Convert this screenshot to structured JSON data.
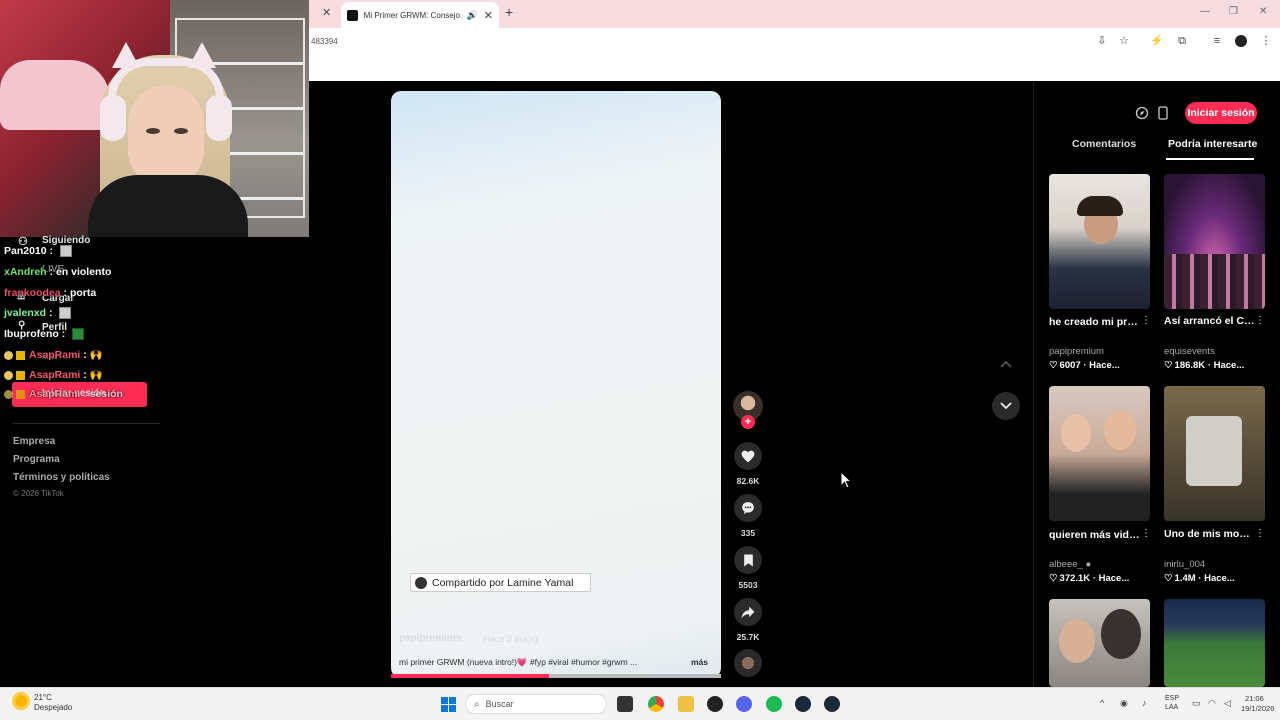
{
  "browser": {
    "tab_title": "Mi Primer GRWM: Consejo",
    "address_fragment": "483394"
  },
  "sidebar": {
    "ghost_items": [
      "Siguiendo",
      "LIVE",
      "Cargar",
      "Perfil",
      "Más"
    ],
    "login_label": "Iniciar sesión",
    "footer_links": [
      "Empresa",
      "Programa",
      "Términos y políticas"
    ],
    "copyright": "© 2026 TikTok"
  },
  "chat": [
    {
      "user": "Pan2010",
      "text": "",
      "color": "#ffffff",
      "emote": true
    },
    {
      "user": "xAndreh",
      "text": "en violento",
      "color": "#6fe36f",
      "emote": false
    },
    {
      "user": "frankoodea",
      "text": "porta",
      "color": "#e8506a",
      "emote": false
    },
    {
      "user": "jvalenxd",
      "text": "",
      "color": "#7ef0a0",
      "emote": true
    },
    {
      "user": "Ibuprofeno",
      "text": "",
      "color": "#ffffff",
      "emote": false
    },
    {
      "user": "AsapRami",
      "text": "🙌",
      "color": "#f05a6e",
      "emote": false
    },
    {
      "user": "AsapRami",
      "text": "🙌",
      "color": "#f05a6e",
      "emote": false
    },
    {
      "user": "AsapRami",
      "text": "sesión",
      "color": "#f05a6e",
      "emote": false
    }
  ],
  "video": {
    "shared_by": "Compartido por Lamine Yamal",
    "username": "papipremium",
    "time_ago": "· Hace 2 día(s)",
    "description": "mi primer GRWM (nueva intro!)💗 #fyp #viral #humor #grwm ...",
    "more_label": "más",
    "progress": 0.48,
    "likes": "82.6K",
    "comments": "335",
    "saves": "5503",
    "shares": "25.7K"
  },
  "right_panel": {
    "login_button": "Iniciar sesión",
    "tabs": [
      "Comentarios",
      "Podría interesarte"
    ],
    "active_tab": 1,
    "recommendations": [
      {
        "title": "he creado mi propio gta VI 💪 ...",
        "author": "papipremium",
        "likes": "6007",
        "time": "· Hace..."
      },
      {
        "title": "Así arrancó el CUMPLE DEL AÑ...",
        "author": "equisevents",
        "likes": "186.8K",
        "time": "· Hace..."
      },
      {
        "title": "quieren más videos así? 💗 🎤",
        "author": "albeee_ ●",
        "likes": "372.1K",
        "time": "· Hace..."
      },
      {
        "title": "Uno de mis momentos más...",
        "author": "inirlu_004",
        "likes": "1.4M",
        "time": "· Hace..."
      },
      {
        "title": "",
        "author": "",
        "likes": "",
        "time": ""
      },
      {
        "title": "",
        "author": "",
        "likes": "",
        "time": ""
      }
    ]
  },
  "taskbar": {
    "temperature": "21°C",
    "weather": "Despejado",
    "search_placeholder": "Buscar",
    "lang_line1": "ESP",
    "lang_line2": "LAA",
    "time": "21:06",
    "date": "19/1/2026"
  },
  "colors": {
    "accent": "#fe2c55",
    "tab_bar": "#f7dde0"
  }
}
